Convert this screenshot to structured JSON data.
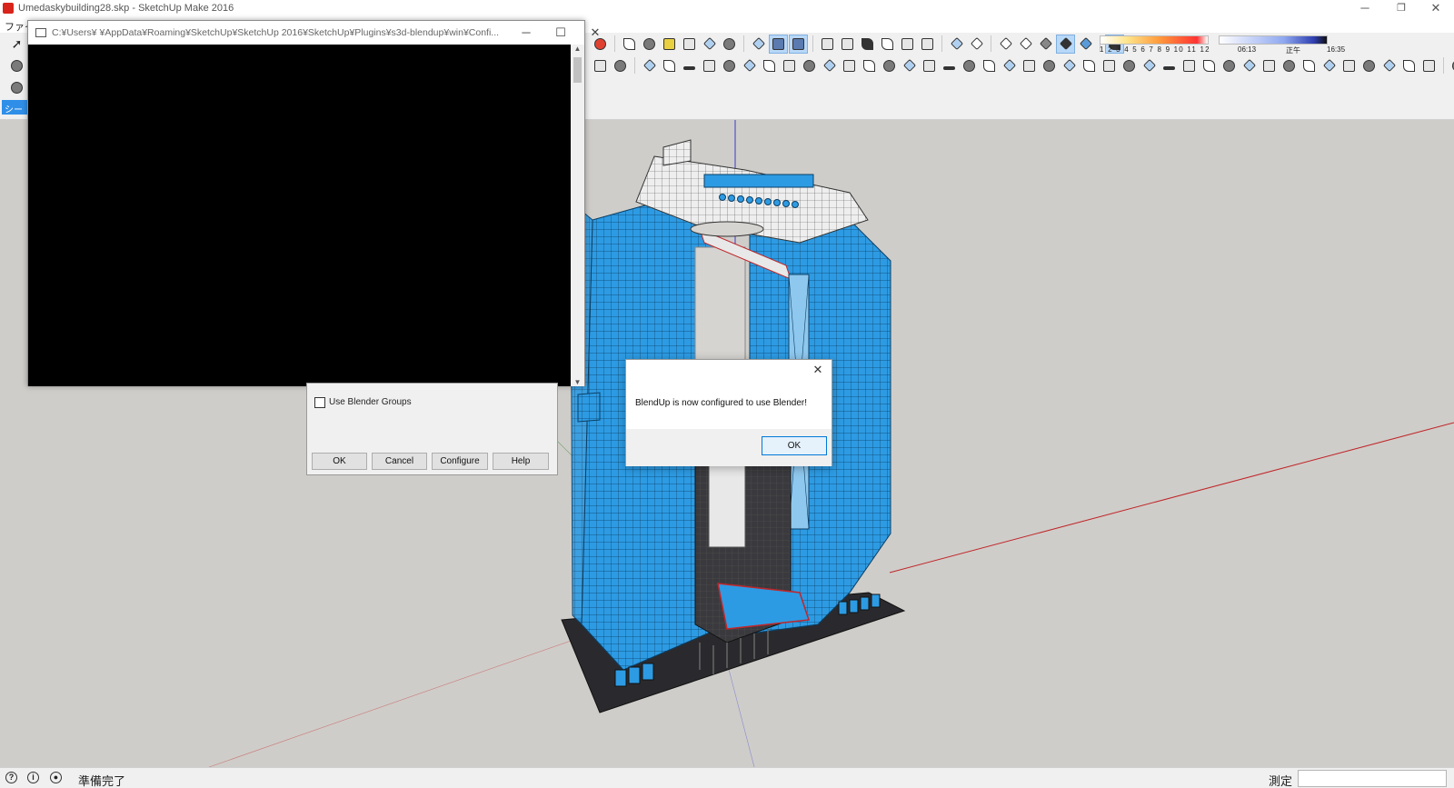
{
  "window": {
    "title": "Umedaskybuilding28.skp - SketchUp Make 2016",
    "minimize": "─",
    "restore": "❐",
    "close": "✕"
  },
  "menubar": {
    "file": "ファイ"
  },
  "scenes_tab": "シーン",
  "shadow": {
    "hours": "1 2 3 4 5 6 7 8 9 10 11 12",
    "time_start": "06:13",
    "time_mid": "正午",
    "time_end": "16:35"
  },
  "console": {
    "title": "C:¥Users¥      ¥AppData¥Roaming¥SketchUp¥SketchUp 2016¥SketchUp¥Plugins¥s3d-blendup¥win¥Confi...",
    "minimize": "─",
    "maximize": "☐",
    "close": "✕"
  },
  "settings_dialog": {
    "checkbox_label": "Use Blender Groups",
    "ok": "OK",
    "cancel": "Cancel",
    "configure": "Configure",
    "help": "Help"
  },
  "message": {
    "text": "BlendUp is now configured to use Blender!",
    "ok": "OK",
    "close": "✕"
  },
  "status": {
    "text": "準備完了",
    "measure_label": "測定",
    "measure_value": ""
  },
  "colors": {
    "viewport": "#cfcdc9",
    "building_blue": "#2d9be3",
    "building_dark": "#2a2a2e",
    "axis_red": "#c0262a",
    "axis_green": "#2a8a2a",
    "axis_blue": "#2a2ad0"
  }
}
